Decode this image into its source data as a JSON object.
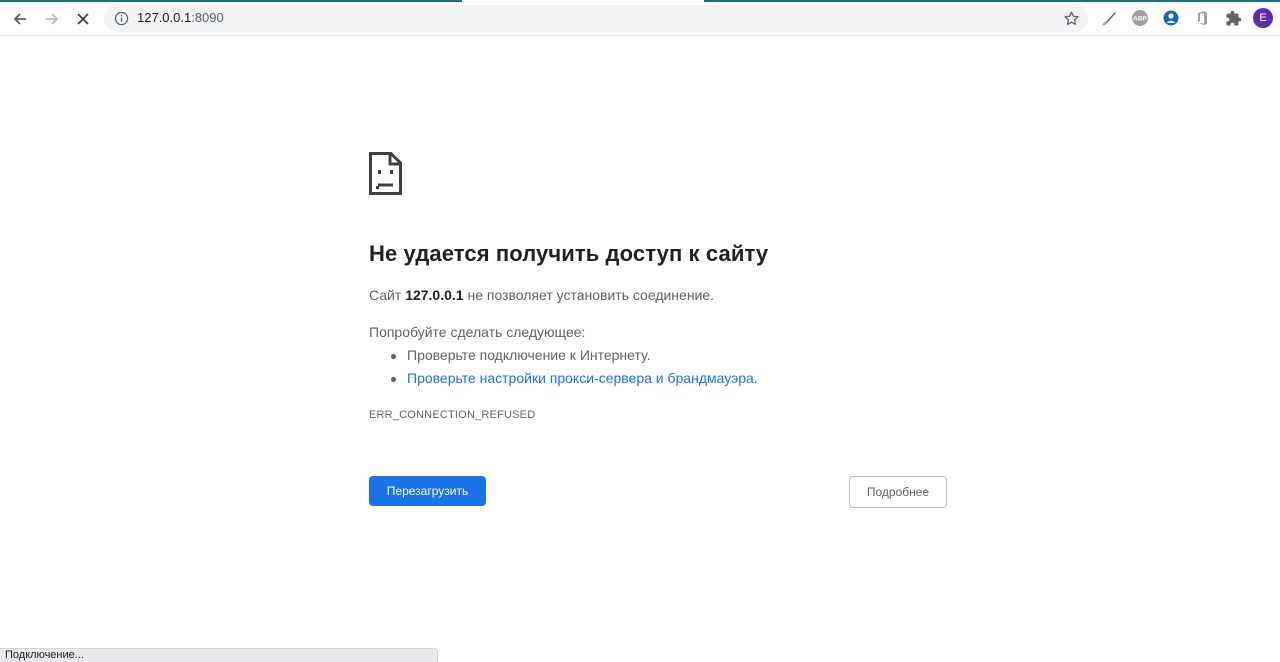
{
  "browser": {
    "url_host": "127.0.0.1",
    "url_port": ":8090",
    "profile_initial": "E",
    "extensions": [
      "pen-extension-icon",
      "adblock-plus-icon",
      "download-extension-icon",
      "office-extension-icon",
      "extensions-puzzle-icon"
    ],
    "accent_color": "#1a73e8",
    "status_text": "Подключение..."
  },
  "error": {
    "heading": "Не удается получить доступ к сайту",
    "summary_prefix": "Сайт ",
    "summary_host": "127.0.0.1",
    "summary_suffix": " не позволяет установить соединение.",
    "suggestions_title": "Попробуйте сделать следующее:",
    "suggestions": [
      "Проверьте подключение к Интернету.",
      "Проверьте настройки прокси-сервера и брандмауэра."
    ],
    "code": "ERR_CONNECTION_REFUSED",
    "reload_label": "Перезагрузить",
    "details_label": "Подробнее"
  }
}
